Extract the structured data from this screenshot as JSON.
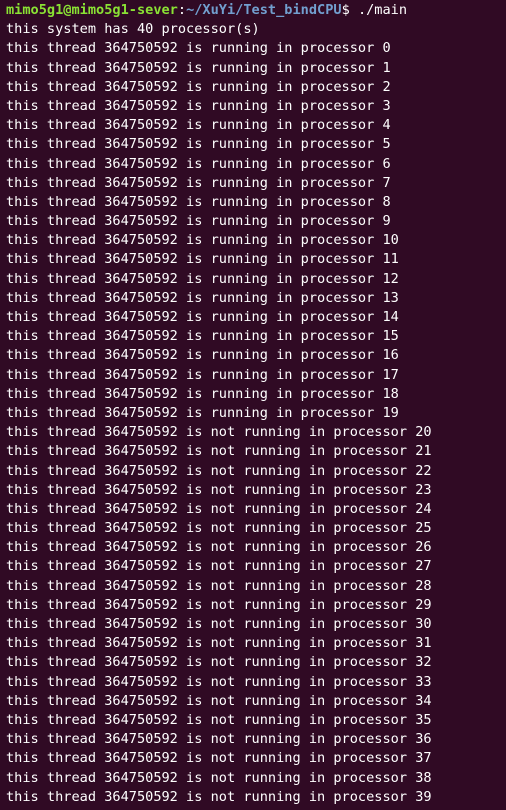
{
  "colors": {
    "background": "#300a24",
    "text": "#ffffff",
    "prompt_user": "#8ae234",
    "prompt_path": "#729fcf"
  },
  "prompt": {
    "user_host": "mimo5g1@mimo5g1-sever",
    "separator": ":",
    "path": "~/XuYi/Test_bindCPU",
    "symbol": "$ ",
    "command": "./main"
  },
  "output": [
    "this system has 40 processor(s)",
    "this thread 364750592 is running in processor 0",
    "this thread 364750592 is running in processor 1",
    "this thread 364750592 is running in processor 2",
    "this thread 364750592 is running in processor 3",
    "this thread 364750592 is running in processor 4",
    "this thread 364750592 is running in processor 5",
    "this thread 364750592 is running in processor 6",
    "this thread 364750592 is running in processor 7",
    "this thread 364750592 is running in processor 8",
    "this thread 364750592 is running in processor 9",
    "this thread 364750592 is running in processor 10",
    "this thread 364750592 is running in processor 11",
    "this thread 364750592 is running in processor 12",
    "this thread 364750592 is running in processor 13",
    "this thread 364750592 is running in processor 14",
    "this thread 364750592 is running in processor 15",
    "this thread 364750592 is running in processor 16",
    "this thread 364750592 is running in processor 17",
    "this thread 364750592 is running in processor 18",
    "this thread 364750592 is running in processor 19",
    "this thread 364750592 is not running in processor 20",
    "this thread 364750592 is not running in processor 21",
    "this thread 364750592 is not running in processor 22",
    "this thread 364750592 is not running in processor 23",
    "this thread 364750592 is not running in processor 24",
    "this thread 364750592 is not running in processor 25",
    "this thread 364750592 is not running in processor 26",
    "this thread 364750592 is not running in processor 27",
    "this thread 364750592 is not running in processor 28",
    "this thread 364750592 is not running in processor 29",
    "this thread 364750592 is not running in processor 30",
    "this thread 364750592 is not running in processor 31",
    "this thread 364750592 is not running in processor 32",
    "this thread 364750592 is not running in processor 33",
    "this thread 364750592 is not running in processor 34",
    "this thread 364750592 is not running in processor 35",
    "this thread 364750592 is not running in processor 36",
    "this thread 364750592 is not running in processor 37",
    "this thread 364750592 is not running in processor 38",
    "this thread 364750592 is not running in processor 39"
  ]
}
